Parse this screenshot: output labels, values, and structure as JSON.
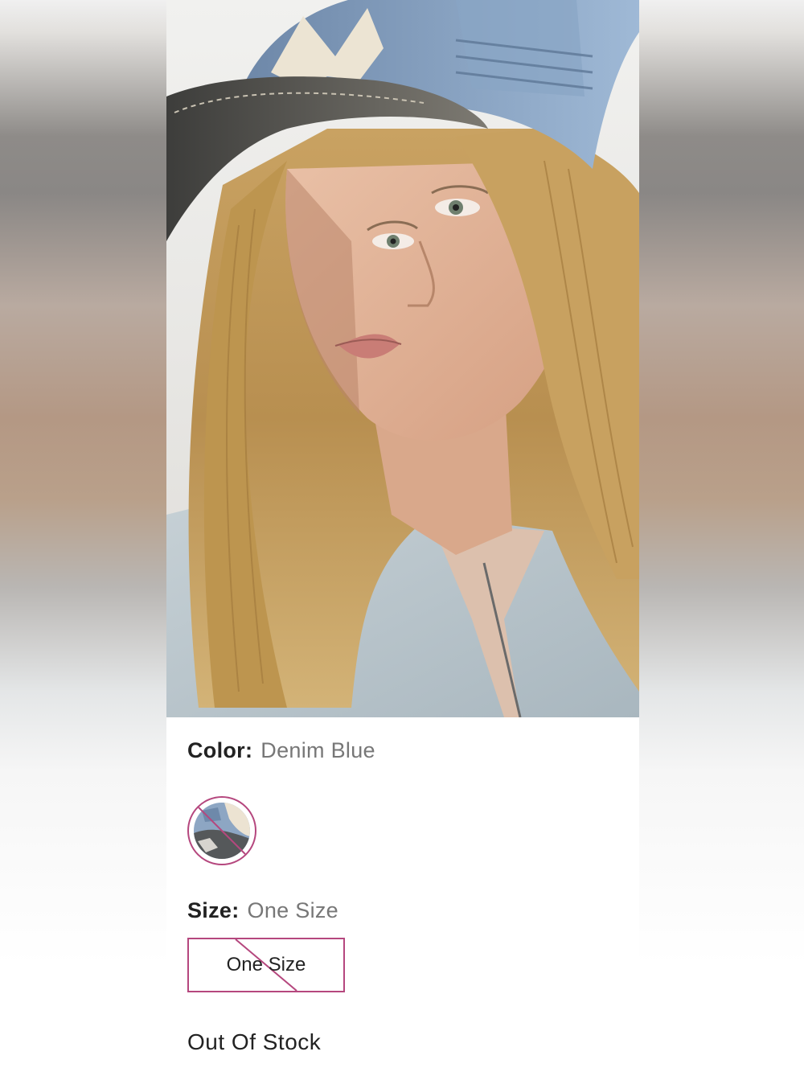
{
  "product": {
    "image_alt": "Model wearing denim baseball cap and light denim zip jacket",
    "color": {
      "label": "Color:",
      "value": "Denim Blue"
    },
    "swatches": [
      {
        "name": "Denim Blue",
        "available": false
      }
    ],
    "size": {
      "label": "Size:",
      "value": "One Size"
    },
    "size_options": [
      {
        "label": "One Size",
        "available": false
      }
    ],
    "stock_status": "Out Of Stock"
  },
  "colors": {
    "accent": "#b5477e",
    "label_text": "#222222",
    "value_text": "#777777"
  },
  "icons": {
    "unavailable_marker": "diagonal-strike-icon"
  }
}
